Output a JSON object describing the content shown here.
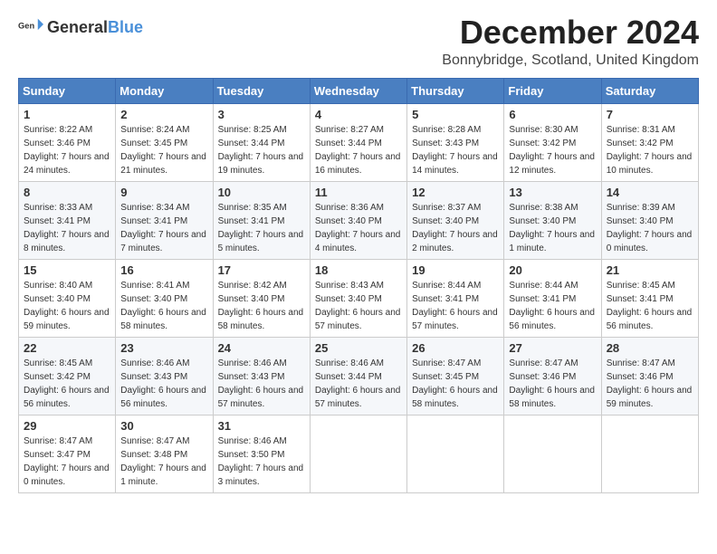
{
  "logo": {
    "general": "General",
    "blue": "Blue"
  },
  "header": {
    "month": "December 2024",
    "location": "Bonnybridge, Scotland, United Kingdom"
  },
  "weekdays": [
    "Sunday",
    "Monday",
    "Tuesday",
    "Wednesday",
    "Thursday",
    "Friday",
    "Saturday"
  ],
  "weeks": [
    [
      {
        "day": "1",
        "sunrise": "8:22 AM",
        "sunset": "3:46 PM",
        "daylight": "7 hours and 24 minutes."
      },
      {
        "day": "2",
        "sunrise": "8:24 AM",
        "sunset": "3:45 PM",
        "daylight": "7 hours and 21 minutes."
      },
      {
        "day": "3",
        "sunrise": "8:25 AM",
        "sunset": "3:44 PM",
        "daylight": "7 hours and 19 minutes."
      },
      {
        "day": "4",
        "sunrise": "8:27 AM",
        "sunset": "3:44 PM",
        "daylight": "7 hours and 16 minutes."
      },
      {
        "day": "5",
        "sunrise": "8:28 AM",
        "sunset": "3:43 PM",
        "daylight": "7 hours and 14 minutes."
      },
      {
        "day": "6",
        "sunrise": "8:30 AM",
        "sunset": "3:42 PM",
        "daylight": "7 hours and 12 minutes."
      },
      {
        "day": "7",
        "sunrise": "8:31 AM",
        "sunset": "3:42 PM",
        "daylight": "7 hours and 10 minutes."
      }
    ],
    [
      {
        "day": "8",
        "sunrise": "8:33 AM",
        "sunset": "3:41 PM",
        "daylight": "7 hours and 8 minutes."
      },
      {
        "day": "9",
        "sunrise": "8:34 AM",
        "sunset": "3:41 PM",
        "daylight": "7 hours and 7 minutes."
      },
      {
        "day": "10",
        "sunrise": "8:35 AM",
        "sunset": "3:41 PM",
        "daylight": "7 hours and 5 minutes."
      },
      {
        "day": "11",
        "sunrise": "8:36 AM",
        "sunset": "3:40 PM",
        "daylight": "7 hours and 4 minutes."
      },
      {
        "day": "12",
        "sunrise": "8:37 AM",
        "sunset": "3:40 PM",
        "daylight": "7 hours and 2 minutes."
      },
      {
        "day": "13",
        "sunrise": "8:38 AM",
        "sunset": "3:40 PM",
        "daylight": "7 hours and 1 minute."
      },
      {
        "day": "14",
        "sunrise": "8:39 AM",
        "sunset": "3:40 PM",
        "daylight": "7 hours and 0 minutes."
      }
    ],
    [
      {
        "day": "15",
        "sunrise": "8:40 AM",
        "sunset": "3:40 PM",
        "daylight": "6 hours and 59 minutes."
      },
      {
        "day": "16",
        "sunrise": "8:41 AM",
        "sunset": "3:40 PM",
        "daylight": "6 hours and 58 minutes."
      },
      {
        "day": "17",
        "sunrise": "8:42 AM",
        "sunset": "3:40 PM",
        "daylight": "6 hours and 58 minutes."
      },
      {
        "day": "18",
        "sunrise": "8:43 AM",
        "sunset": "3:40 PM",
        "daylight": "6 hours and 57 minutes."
      },
      {
        "day": "19",
        "sunrise": "8:44 AM",
        "sunset": "3:41 PM",
        "daylight": "6 hours and 57 minutes."
      },
      {
        "day": "20",
        "sunrise": "8:44 AM",
        "sunset": "3:41 PM",
        "daylight": "6 hours and 56 minutes."
      },
      {
        "day": "21",
        "sunrise": "8:45 AM",
        "sunset": "3:41 PM",
        "daylight": "6 hours and 56 minutes."
      }
    ],
    [
      {
        "day": "22",
        "sunrise": "8:45 AM",
        "sunset": "3:42 PM",
        "daylight": "6 hours and 56 minutes."
      },
      {
        "day": "23",
        "sunrise": "8:46 AM",
        "sunset": "3:43 PM",
        "daylight": "6 hours and 56 minutes."
      },
      {
        "day": "24",
        "sunrise": "8:46 AM",
        "sunset": "3:43 PM",
        "daylight": "6 hours and 57 minutes."
      },
      {
        "day": "25",
        "sunrise": "8:46 AM",
        "sunset": "3:44 PM",
        "daylight": "6 hours and 57 minutes."
      },
      {
        "day": "26",
        "sunrise": "8:47 AM",
        "sunset": "3:45 PM",
        "daylight": "6 hours and 58 minutes."
      },
      {
        "day": "27",
        "sunrise": "8:47 AM",
        "sunset": "3:46 PM",
        "daylight": "6 hours and 58 minutes."
      },
      {
        "day": "28",
        "sunrise": "8:47 AM",
        "sunset": "3:46 PM",
        "daylight": "6 hours and 59 minutes."
      }
    ],
    [
      {
        "day": "29",
        "sunrise": "8:47 AM",
        "sunset": "3:47 PM",
        "daylight": "7 hours and 0 minutes."
      },
      {
        "day": "30",
        "sunrise": "8:47 AM",
        "sunset": "3:48 PM",
        "daylight": "7 hours and 1 minute."
      },
      {
        "day": "31",
        "sunrise": "8:46 AM",
        "sunset": "3:50 PM",
        "daylight": "7 hours and 3 minutes."
      },
      null,
      null,
      null,
      null
    ]
  ]
}
